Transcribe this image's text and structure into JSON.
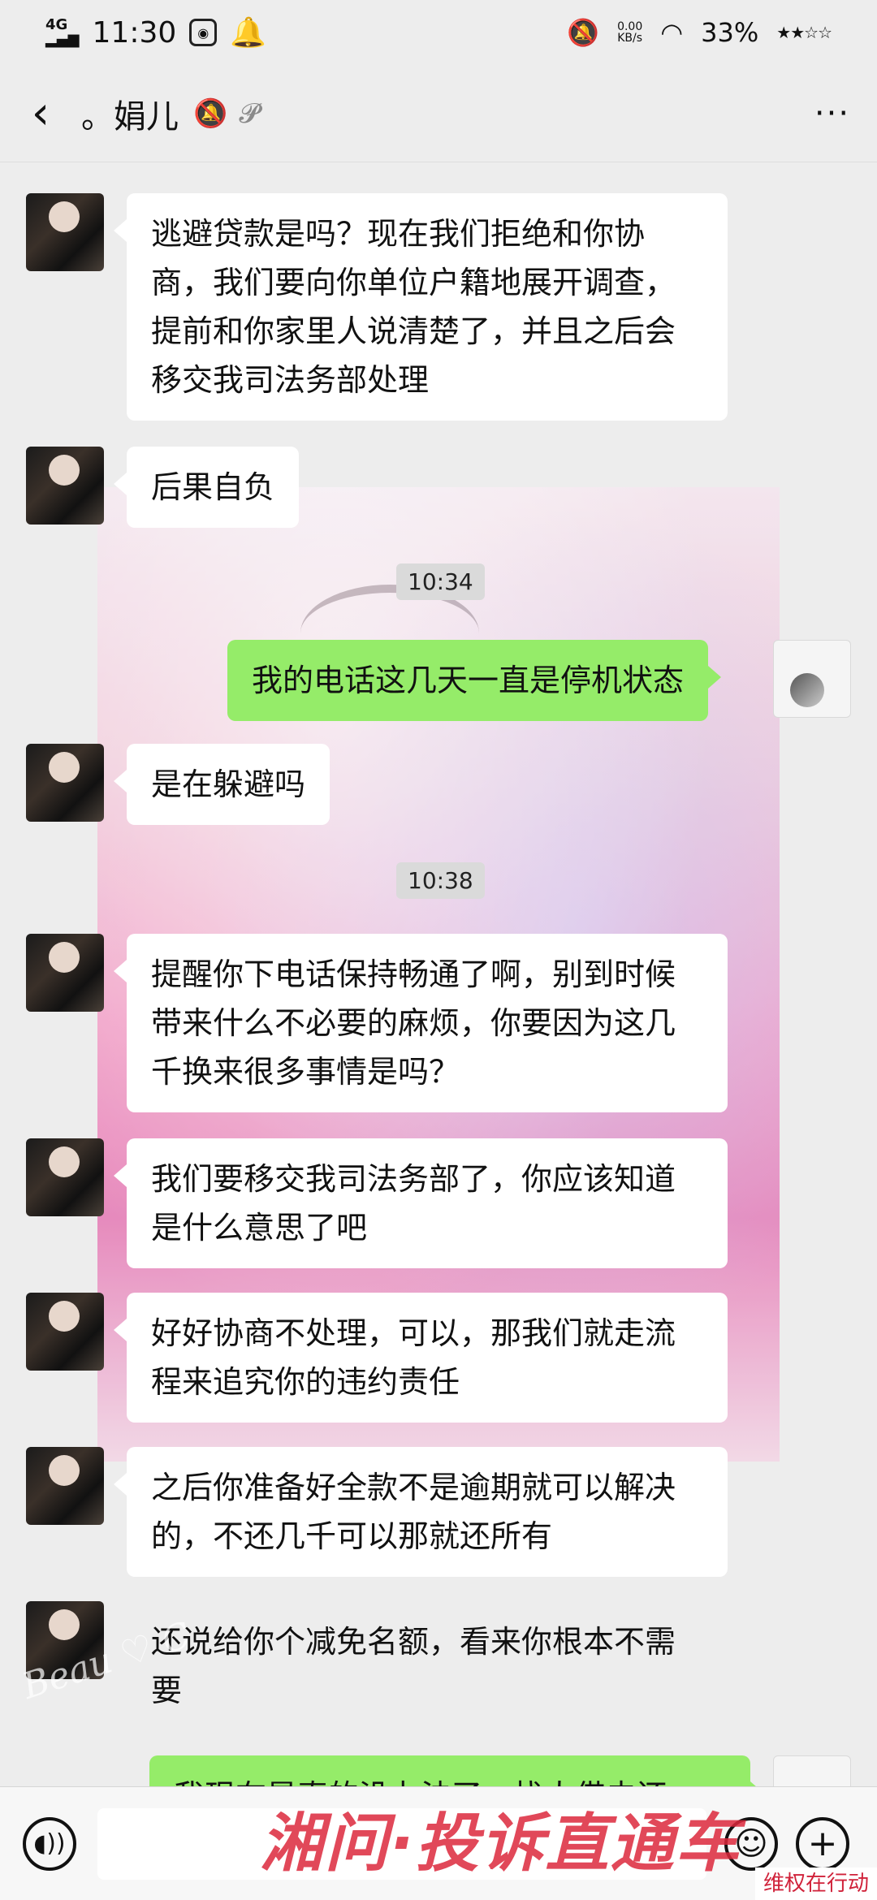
{
  "status_bar": {
    "network": "4G",
    "time": "11:30",
    "speed_value": "0.00",
    "speed_unit": "KB/s",
    "battery": "33%",
    "icons": [
      "signal-icon",
      "app-badge-icon",
      "notification-bell-icon",
      "mute-icon",
      "wifi-icon"
    ]
  },
  "header": {
    "title": "。娟儿",
    "icons": [
      "mute-notification-icon",
      "ear-mode-icon"
    ],
    "more_label": "···"
  },
  "messages": [
    {
      "from": "them",
      "text": "逃避贷款是吗？现在我们拒绝和你协商，我们要向你单位户籍地展开调查，提前和你家里人说清楚了，并且之后会移交我司法务部处理"
    },
    {
      "from": "them",
      "text": "后果自负"
    },
    {
      "type": "time",
      "text": "10:34"
    },
    {
      "from": "me",
      "text": "我的电话这几天一直是停机状态"
    },
    {
      "from": "them",
      "text": "是在躲避吗"
    },
    {
      "type": "time",
      "text": "10:38"
    },
    {
      "from": "them",
      "text": "提醒你下电话保持畅通了啊，别到时候带来什么不必要的麻烦，你要因为这几千换来很多事情是吗？"
    },
    {
      "from": "them",
      "text": "我们要移交我司法务部了，你应该知道是什么意思了吧"
    },
    {
      "from": "them",
      "text": "好好协商不处理，可以，那我们就走流程来追究你的违约责任"
    },
    {
      "from": "them",
      "text": "之后你准备好全款不是逾期就可以解决的，不还几千可以那就还所有"
    },
    {
      "from": "them",
      "text": "还说给你个减免名额，看来你根本不需要"
    },
    {
      "from": "me",
      "text": "我现在是真的没办法了，找人借去还"
    }
  ],
  "input_bar": {
    "voice_icon": "voice-icon",
    "emoji_icon": "emoji-icon",
    "plus_icon": "plus-icon"
  },
  "watermark": {
    "banner": "湘问·投诉直通车",
    "corner": "维权在行动"
  }
}
